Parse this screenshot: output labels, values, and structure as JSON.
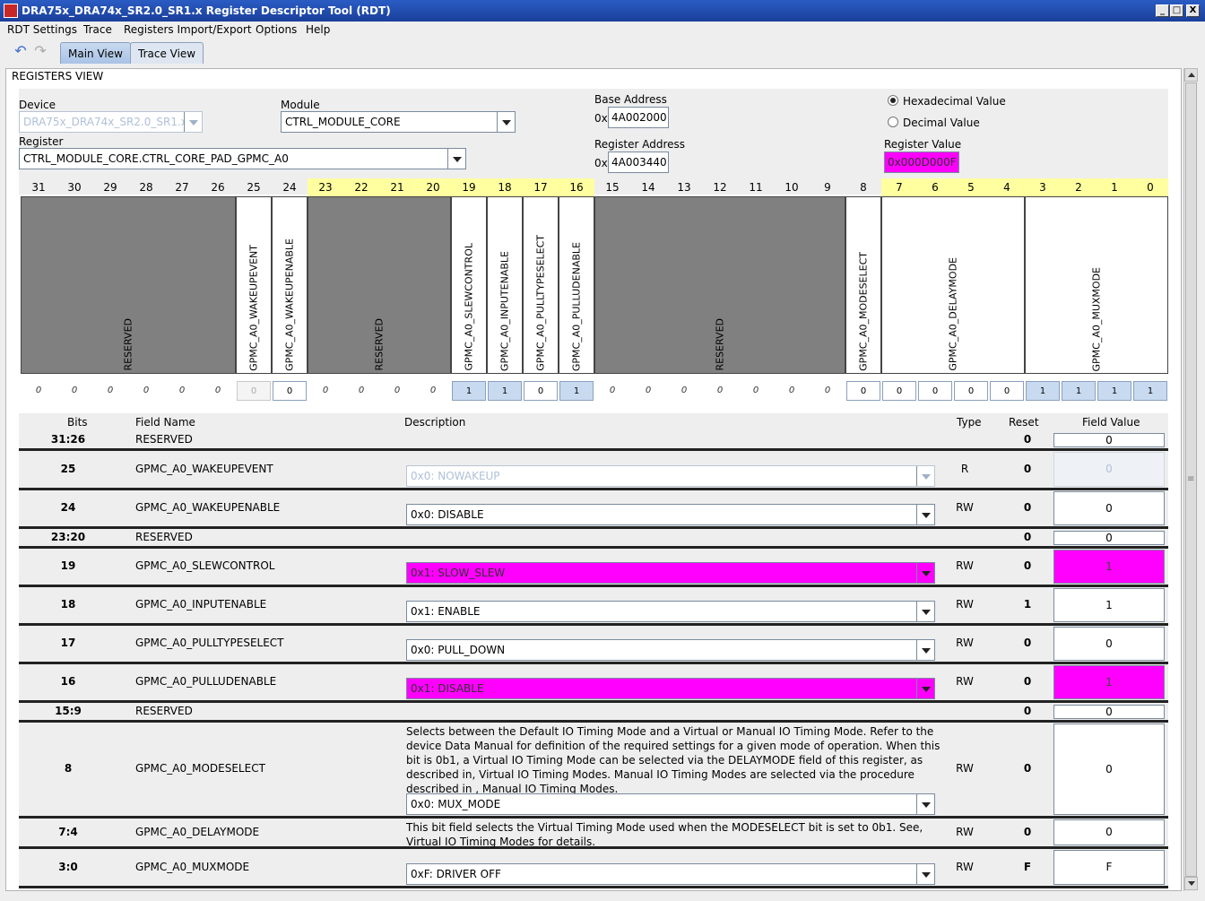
{
  "window": {
    "title": "DRA75x_DRA74x_SR2.0_SR1.x Register Descriptor Tool (RDT)",
    "min": "_",
    "max": "□",
    "close": "X"
  },
  "menu": [
    "RDT Settings",
    "Trace",
    "Registers Import/Export",
    "Options",
    "Help"
  ],
  "toolbar": {
    "undo_icon": "↶",
    "redo_icon": "↷"
  },
  "tabs": [
    "Main View",
    "Trace View"
  ],
  "panel_title": "REGISTERS VIEW",
  "form": {
    "device_label": "Device",
    "device_value": "DRA75x_DRA74x_SR2.0_SR1.x",
    "module_label": "Module",
    "module_value": "CTRL_MODULE_CORE",
    "register_label": "Register",
    "register_value": "CTRL_MODULE_CORE.CTRL_CORE_PAD_GPMC_A0",
    "base_label": "Base Address",
    "base_prefix": "0x",
    "base_value": "4A002000",
    "regaddr_label": "Register Address",
    "regaddr_prefix": "0x",
    "regaddr_value": "4A003440",
    "hex_label": "Hexadecimal Value",
    "dec_label": "Decimal Value",
    "regval_label": "Register Value",
    "regval_value": "0x000D000F"
  },
  "bit_numbers": [
    "31",
    "30",
    "29",
    "28",
    "27",
    "26",
    "25",
    "24",
    "23",
    "22",
    "21",
    "20",
    "19",
    "18",
    "17",
    "16",
    "15",
    "14",
    "13",
    "12",
    "11",
    "10",
    "9",
    "8",
    "7",
    "6",
    "5",
    "4",
    "3",
    "2",
    "1",
    "0"
  ],
  "bit_fields": [
    "RESERVED",
    "GPMC_A0_WAKEUPEVENT",
    "GPMC_A0_WAKEUPENABLE",
    "RESERVED",
    "GPMC_A0_SLEWCONTROL",
    "GPMC_A0_INPUTENABLE",
    "GPMC_A0_PULLTYPESELECT",
    "GPMC_A0_PULLUDENABLE",
    "RESERVED",
    "GPMC_A0_MODESELECT",
    "GPMC_A0_DELAYMODE",
    "GPMC_A0_MUXMODE"
  ],
  "bit_values": [
    "0",
    "0",
    "0",
    "0",
    "0",
    "0",
    "0",
    "0",
    "0",
    "0",
    "0",
    "0",
    "1",
    "1",
    "0",
    "1",
    "0",
    "0",
    "0",
    "0",
    "0",
    "0",
    "0",
    "0",
    "0",
    "0",
    "0",
    "0",
    "1",
    "1",
    "1",
    "1"
  ],
  "table": {
    "headers": {
      "bits": "Bits",
      "name": "Field Name",
      "desc": "Description",
      "type": "Type",
      "reset": "Reset",
      "value": "Field Value"
    },
    "rows": [
      {
        "bits": "31:26",
        "name": "RESERVED",
        "desc": "",
        "combo": "",
        "type": "",
        "reset": "0",
        "value": "0"
      },
      {
        "bits": "25",
        "name": "GPMC_A0_WAKEUPEVENT",
        "desc": "",
        "combo": "0x0: NOWAKEUP",
        "type": "R",
        "reset": "0",
        "value": "0"
      },
      {
        "bits": "24",
        "name": "GPMC_A0_WAKEUPENABLE",
        "desc": "",
        "combo": "0x0: DISABLE",
        "type": "RW",
        "reset": "0",
        "value": "0"
      },
      {
        "bits": "23:20",
        "name": "RESERVED",
        "desc": "",
        "combo": "",
        "type": "",
        "reset": "0",
        "value": "0"
      },
      {
        "bits": "19",
        "name": "GPMC_A0_SLEWCONTROL",
        "desc": "",
        "combo": "0x1: SLOW_SLEW",
        "type": "RW",
        "reset": "0",
        "value": "1"
      },
      {
        "bits": "18",
        "name": "GPMC_A0_INPUTENABLE",
        "desc": "",
        "combo": "0x1: ENABLE",
        "type": "RW",
        "reset": "1",
        "value": "1"
      },
      {
        "bits": "17",
        "name": "GPMC_A0_PULLTYPESELECT",
        "desc": "",
        "combo": "0x0: PULL_DOWN",
        "type": "RW",
        "reset": "0",
        "value": "0"
      },
      {
        "bits": "16",
        "name": "GPMC_A0_PULLUDENABLE",
        "desc": "",
        "combo": "0x1: DISABLE",
        "type": "RW",
        "reset": "0",
        "value": "1"
      },
      {
        "bits": "15:9",
        "name": "RESERVED",
        "desc": "",
        "combo": "",
        "type": "",
        "reset": "0",
        "value": "0"
      },
      {
        "bits": "8",
        "name": "GPMC_A0_MODESELECT",
        "desc": "Selects between the Default IO Timing Mode and a Virtual or Manual IO Timing Mode. Refer to the device Data Manual for definition of the required settings for a given mode of operation. When this bit is 0b1, a Virtual IO Timing Mode can be selected via the DELAYMODE field of this register, as described in, Virtual IO Timing Modes. Manual IO Timing Modes are selected via the procedure described in , Manual IO Timing Modes.",
        "combo": "0x0: MUX_MODE",
        "type": "RW",
        "reset": "0",
        "value": "0"
      },
      {
        "bits": "7:4",
        "name": "GPMC_A0_DELAYMODE",
        "desc": "This bit field selects the Virtual Timing Mode used when the MODESELECT bit is set to 0b1. See, Virtual IO Timing Modes for details.",
        "combo": "",
        "type": "RW",
        "reset": "0",
        "value": "0"
      },
      {
        "bits": "3:0",
        "name": "GPMC_A0_MUXMODE",
        "desc": "",
        "combo": "0xF: DRIVER OFF",
        "type": "RW",
        "reset": "F",
        "value": "F"
      }
    ]
  },
  "colors": {
    "highlight": "#ff00ff",
    "reserved": "#808080",
    "yellow_header": "#ffffa0"
  }
}
